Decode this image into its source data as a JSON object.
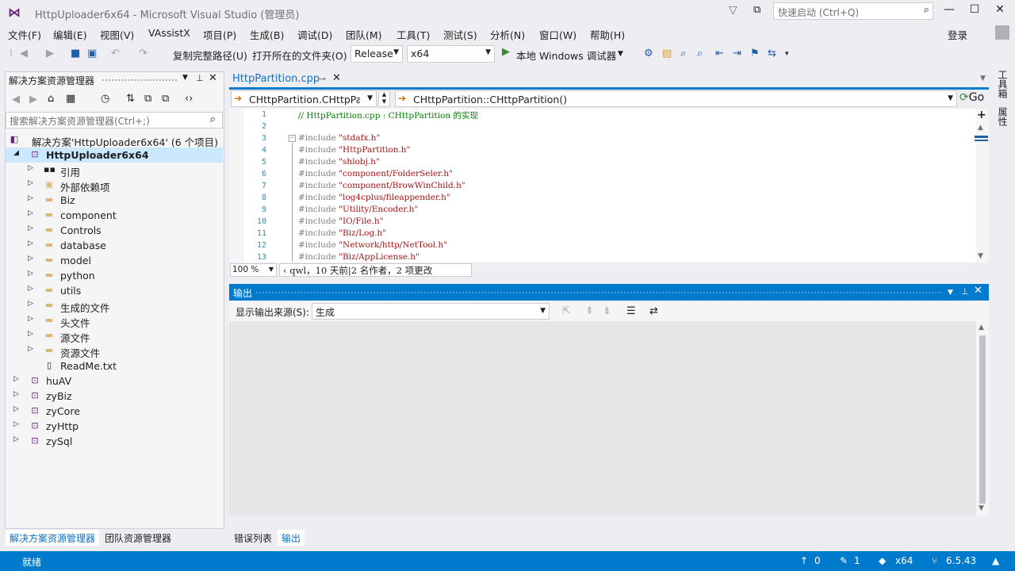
{
  "window": {
    "title": "HttpUploader6x64 - Microsoft Visual Studio (管理员)",
    "quick_launch_placeholder": "快速启动 (Ctrl+Q)",
    "minimize": "—",
    "maximize": "☐",
    "close": "✕"
  },
  "menu": [
    "文件(F)",
    "编辑(E)",
    "视图(V)",
    "VAssistX",
    "项目(P)",
    "生成(B)",
    "调试(D)",
    "团队(M)",
    "工具(T)",
    "测试(S)",
    "分析(N)",
    "窗口(W)",
    "帮助(H)"
  ],
  "login": "登录",
  "toolbar": {
    "copy_path": "复制完整路径(U)",
    "open_folder": "打开所在的文件夹(O)",
    "config": "Release",
    "platform": "x64",
    "run_label": "本地 Windows 调试器"
  },
  "solution_explorer": {
    "title": "解决方案资源管理器",
    "search_placeholder": "搜索解决方案资源管理器(Ctrl+;)",
    "solution_label": "解决方案'HttpUploader6x64' (6 个项目)",
    "tree": [
      {
        "label": "HttpUploader6x64",
        "level": 1,
        "type": "project",
        "expanded": true,
        "selected": true
      },
      {
        "label": "引用",
        "level": 2,
        "type": "ref"
      },
      {
        "label": "外部依赖项",
        "level": 2,
        "type": "ext"
      },
      {
        "label": "Biz",
        "level": 2,
        "type": "folder"
      },
      {
        "label": "component",
        "level": 2,
        "type": "folder"
      },
      {
        "label": "Controls",
        "level": 2,
        "type": "folder"
      },
      {
        "label": "database",
        "level": 2,
        "type": "folder"
      },
      {
        "label": "model",
        "level": 2,
        "type": "folder"
      },
      {
        "label": "python",
        "level": 2,
        "type": "folder"
      },
      {
        "label": "utils",
        "level": 2,
        "type": "folder"
      },
      {
        "label": "生成的文件",
        "level": 2,
        "type": "folder"
      },
      {
        "label": "头文件",
        "level": 2,
        "type": "folder"
      },
      {
        "label": "源文件",
        "level": 2,
        "type": "folder"
      },
      {
        "label": "资源文件",
        "level": 2,
        "type": "folder"
      },
      {
        "label": "ReadMe.txt",
        "level": 2,
        "type": "file"
      },
      {
        "label": "huAV",
        "level": 1,
        "type": "project"
      },
      {
        "label": "zyBiz",
        "level": 1,
        "type": "project"
      },
      {
        "label": "zyCore",
        "level": 1,
        "type": "project"
      },
      {
        "label": "zyHttp",
        "level": 1,
        "type": "project"
      },
      {
        "label": "zySql",
        "level": 1,
        "type": "project"
      }
    ],
    "tab_solution": "解决方案资源管理器",
    "tab_team": "团队资源管理器"
  },
  "editor": {
    "tab_label": "HttpPartition.cpp",
    "nav_class": "CHttpPartition.CHttpParti",
    "nav_member": "CHttpPartition::CHttpPartition()",
    "go_label": "Go",
    "lines": [
      {
        "n": "1",
        "text": "// HttpPartition.cpp : CHttpPartition 的实现",
        "kind": "comment"
      },
      {
        "n": "2",
        "text": "",
        "kind": "plain"
      },
      {
        "n": "3",
        "pp": "#include ",
        "str": "\"stdafx.h\"",
        "kind": "include"
      },
      {
        "n": "4",
        "pp": "#include ",
        "str": "\"HttpPartition.h\"",
        "kind": "include"
      },
      {
        "n": "5",
        "pp": "#include ",
        "str": "\"shlobj.h\"",
        "kind": "include"
      },
      {
        "n": "6",
        "pp": "#include ",
        "str": "\"component/FolderSeler.h\"",
        "kind": "include"
      },
      {
        "n": "7",
        "pp": "#include ",
        "str": "\"component/BrowWinChild.h\"",
        "kind": "include"
      },
      {
        "n": "8",
        "pp": "#include ",
        "str": "\"log4cplus/fileappender.h\"",
        "kind": "include"
      },
      {
        "n": "9",
        "pp": "#include ",
        "str": "\"Utility/Encoder.h\"",
        "kind": "include"
      },
      {
        "n": "10",
        "pp": "#include ",
        "str": "\"IO/File.h\"",
        "kind": "include"
      },
      {
        "n": "11",
        "pp": "#include ",
        "str": "\"Biz/Log.h\"",
        "kind": "include"
      },
      {
        "n": "12",
        "pp": "#include ",
        "str": "\"Network/http/NetTool.h\"",
        "kind": "include"
      },
      {
        "n": "13",
        "pp": "#include ",
        "str": "\"Biz/AppLicense.h\"",
        "kind": "include"
      }
    ],
    "zoom": "100 %",
    "codelens": "qwl，10 天前|2 名作者，2 项更改"
  },
  "output": {
    "title": "输出",
    "source_label": "显示输出来源(S):",
    "source_value": "生成",
    "tab_errors": "错误列表",
    "tab_output": "输出"
  },
  "right_strip": [
    "工具箱",
    "属性"
  ],
  "status": {
    "text": "就绪",
    "up_count": "0",
    "edit_count": "1",
    "repo": "x64",
    "branch": "6.5.43"
  },
  "colors": {
    "accent": "#007acc",
    "selection": "#cce8ff",
    "line_number": "#2b91af",
    "comment": "#008000",
    "string": "#a31515"
  }
}
